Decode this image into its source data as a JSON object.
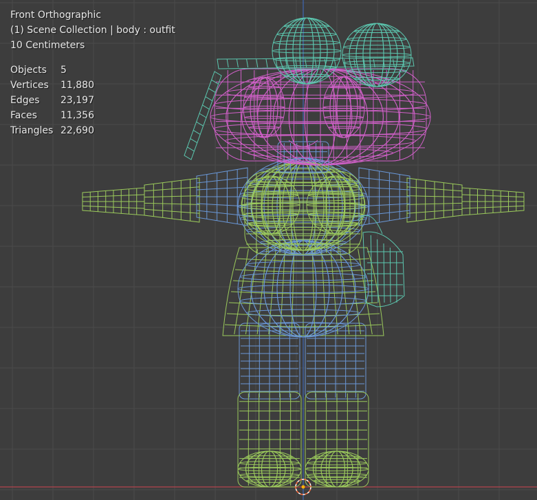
{
  "viewport": {
    "view_name": "Front Orthographic",
    "collection": "(1) Scene Collection | body : outfit",
    "grid_scale": "10 Centimeters"
  },
  "stats": [
    {
      "label": "Objects",
      "value": "5"
    },
    {
      "label": "Vertices",
      "value": "11,880"
    },
    {
      "label": "Edges",
      "value": "23,197"
    },
    {
      "label": "Faces",
      "value": "11,356"
    },
    {
      "label": "Triangles",
      "value": "22,690"
    }
  ],
  "colors": {
    "background": "#3d3d3d",
    "grid_line": "#4a4a4a",
    "x_axis": "#b5444e",
    "z_axis": "#3f68b5",
    "head_wire": "#d060c8",
    "body_wire": "#9ccb5c",
    "inner_wire": "#6a98d8",
    "accessory_wire": "#5cc8b0",
    "origin_cursor": "#ff6a3a"
  }
}
